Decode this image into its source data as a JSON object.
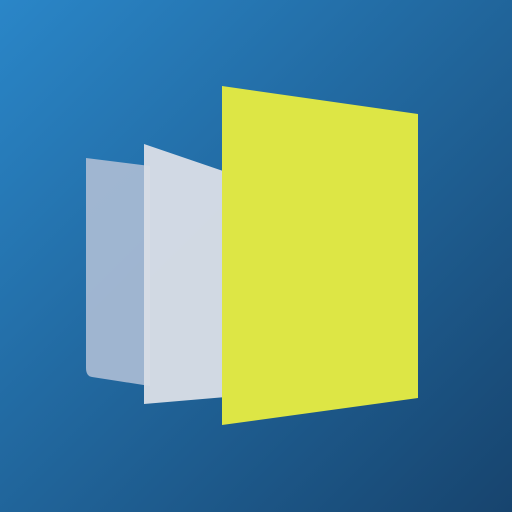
{
  "app_icon": {
    "icon_name": "stacked-pages-icon",
    "colors": {
      "background_top_left": "#2A86C8",
      "background_bottom_right": "#17446E",
      "sheet_back": "#A7B9D3",
      "sheet_middle": "#D8DEE6",
      "sheet_front": "#DDE645"
    }
  }
}
